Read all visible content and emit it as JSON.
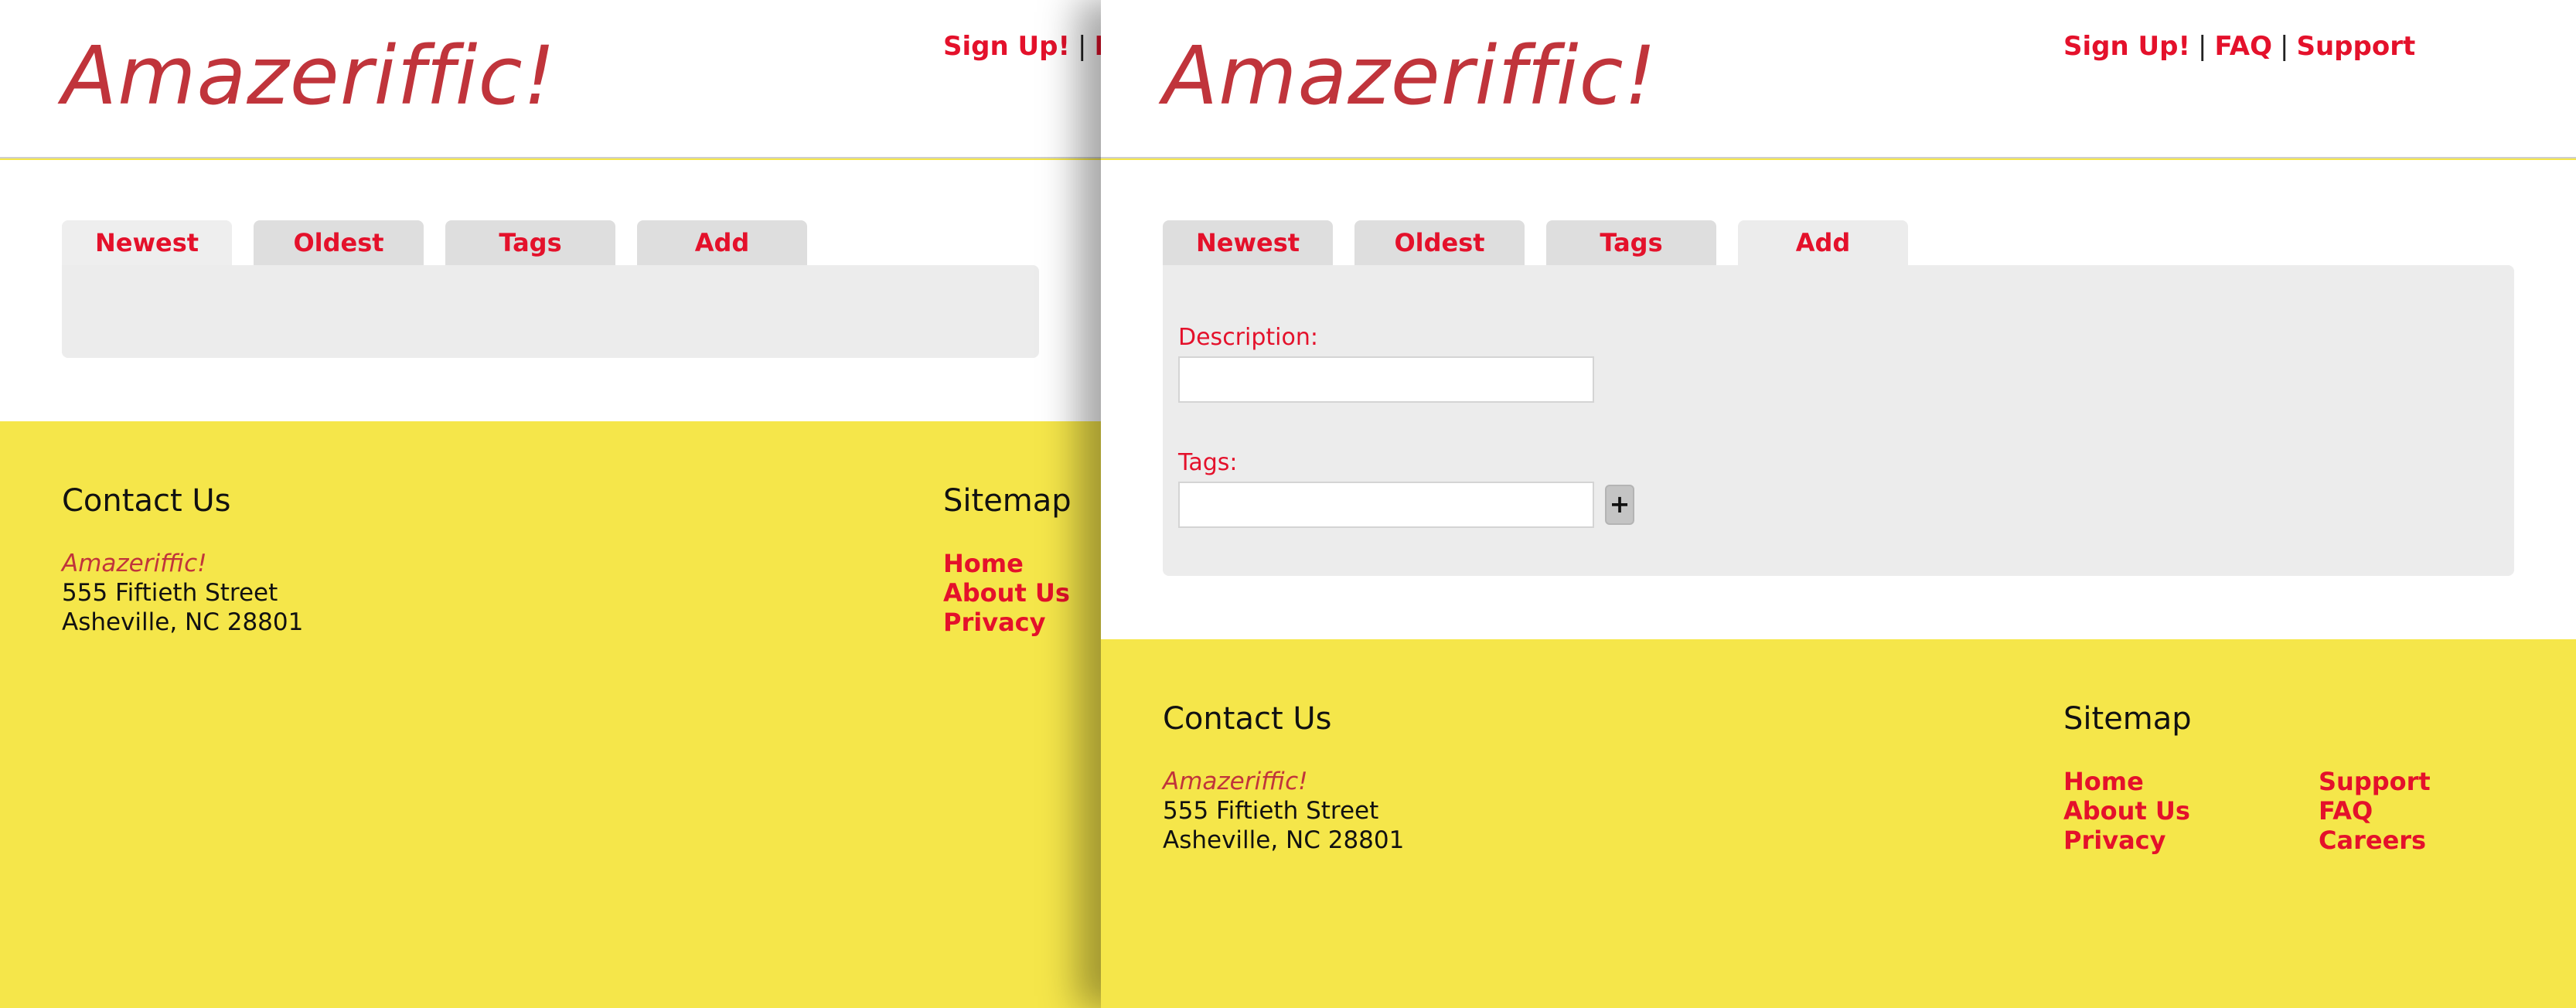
{
  "brand": "Amazeriffic!",
  "top_nav": {
    "signup": "Sign Up!",
    "faq": "FAQ",
    "support": "Support",
    "separator": "|"
  },
  "tabs": [
    {
      "label": "Newest"
    },
    {
      "label": "Oldest"
    },
    {
      "label": "Tags"
    },
    {
      "label": "Add"
    }
  ],
  "active_tab": {
    "left_window": "Newest",
    "right_window": "Add"
  },
  "add_form": {
    "description_label": "Description:",
    "description_value": "",
    "tags_label": "Tags:",
    "tags_value": "",
    "add_tag_button": "+"
  },
  "footer": {
    "contact_title": "Contact Us",
    "address_brand": "Amazeriffic!",
    "address_street": "555 Fiftieth Street",
    "address_city": "Asheville, NC 28801",
    "sitemap_title": "Sitemap",
    "sitemap_col1": [
      "Home",
      "About Us",
      "Privacy"
    ],
    "sitemap_col2": [
      "Support",
      "FAQ",
      "Careers"
    ]
  },
  "colors": {
    "brand": "#c0343b",
    "link": "#e4112b",
    "footer_bg": "#f5e64a",
    "tab_bg": "#dedede",
    "panel_bg": "#ececec"
  }
}
